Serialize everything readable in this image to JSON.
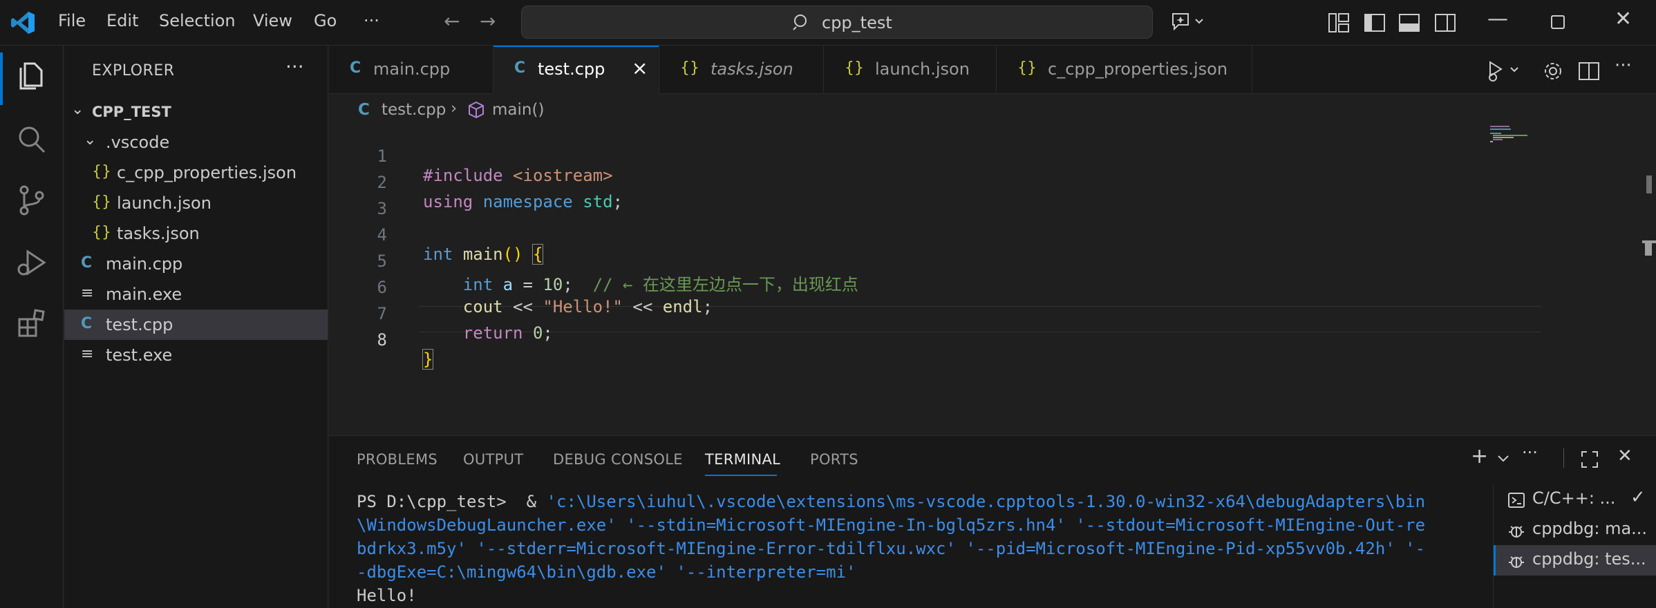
{
  "titlebar": {
    "menu": [
      "File",
      "Edit",
      "Selection",
      "View",
      "Go",
      "···"
    ],
    "search_text": "cpp_test"
  },
  "explorer": {
    "title": "EXPLORER",
    "more": "···",
    "project": "CPP_TEST",
    "items": [
      {
        "label": ".vscode",
        "kind": "folder"
      },
      {
        "label": "c_cpp_properties.json",
        "kind": "json"
      },
      {
        "label": "launch.json",
        "kind": "json"
      },
      {
        "label": "tasks.json",
        "kind": "json"
      },
      {
        "label": "main.cpp",
        "kind": "cpp"
      },
      {
        "label": "main.exe",
        "kind": "exe"
      },
      {
        "label": "test.cpp",
        "kind": "cpp",
        "selected": true
      },
      {
        "label": "test.exe",
        "kind": "exe"
      }
    ]
  },
  "tabs": [
    {
      "label": "main.cpp",
      "icon": "cpp-file-icon"
    },
    {
      "label": "test.cpp",
      "icon": "cpp-file-icon",
      "active": true
    },
    {
      "label": "tasks.json",
      "icon": "json-file-icon",
      "italic": true
    },
    {
      "label": "launch.json",
      "icon": "json-file-icon"
    },
    {
      "label": "c_cpp_properties.json",
      "icon": "json-file-icon"
    }
  ],
  "breadcrumb": {
    "file": "test.cpp",
    "symbol": "main()"
  },
  "code": {
    "line_numbers": [
      "1",
      "2",
      "3",
      "4",
      "5",
      "6",
      "7",
      "8"
    ],
    "current_line": "8",
    "l1_pp": "#include",
    "l1_hdr": "<iostream>",
    "l2_using": "using",
    "l2_namespace": "namespace",
    "l2_std": "std",
    "l2_semi": ";",
    "l4_int": "int",
    "l4_main": "main",
    "l4_parens": "()",
    "l4_brace": "{",
    "l5_int": "int",
    "l5_a": "a",
    "l5_eq": " = ",
    "l5_num": "10",
    "l5_semi": ";",
    "l5_comment": "// ← 在这里左边点一下，出现红点",
    "l6_cout": "cout",
    "l6_op1": " << ",
    "l6_str": "\"Hello!\"",
    "l6_op2": " << ",
    "l6_endl": "endl",
    "l6_semi": ";",
    "l7_return": "return",
    "l7_num": "0",
    "l7_semi": ";",
    "l8_brace": "}"
  },
  "panel": {
    "tabs": [
      "PROBLEMS",
      "OUTPUT",
      "DEBUG CONSOLE",
      "TERMINAL",
      "PORTS"
    ],
    "active_tab": "TERMINAL",
    "terminal_prompt": "PS D:\\cpp_test>  & ",
    "terminal_cmd_l1": "'c:\\Users\\iuhul\\.vscode\\extensions\\ms-vscode.cpptools-1.30.0-win32-x64\\debugAdapters\\bin",
    "terminal_cmd_l2": "\\WindowsDebugLauncher.exe' '--stdin=Microsoft-MIEngine-In-bglq5zrs.hn4' '--stdout=Microsoft-MIEngine-Out-re",
    "terminal_cmd_l3": "bdrkx3.m5y' '--stderr=Microsoft-MIEngine-Error-tdilflxu.wxc' '--pid=Microsoft-MIEngine-Pid-xp55vv0b.42h' '-",
    "terminal_cmd_l4": "-dbgExe=C:\\mingw64\\bin\\gdb.exe' '--interpreter=mi'",
    "terminal_output": "Hello!",
    "terminals": [
      {
        "label": "C/C++: ...",
        "icon": "terminal-icon",
        "check": true
      },
      {
        "label": "cppdbg: ma...",
        "icon": "debug-icon"
      },
      {
        "label": "cppdbg: tes...",
        "icon": "debug-icon",
        "selected": true
      }
    ]
  },
  "colors": {
    "accent": "#0078d4",
    "json_icon": "#cbcb41",
    "cpp_icon": "#519aba"
  }
}
